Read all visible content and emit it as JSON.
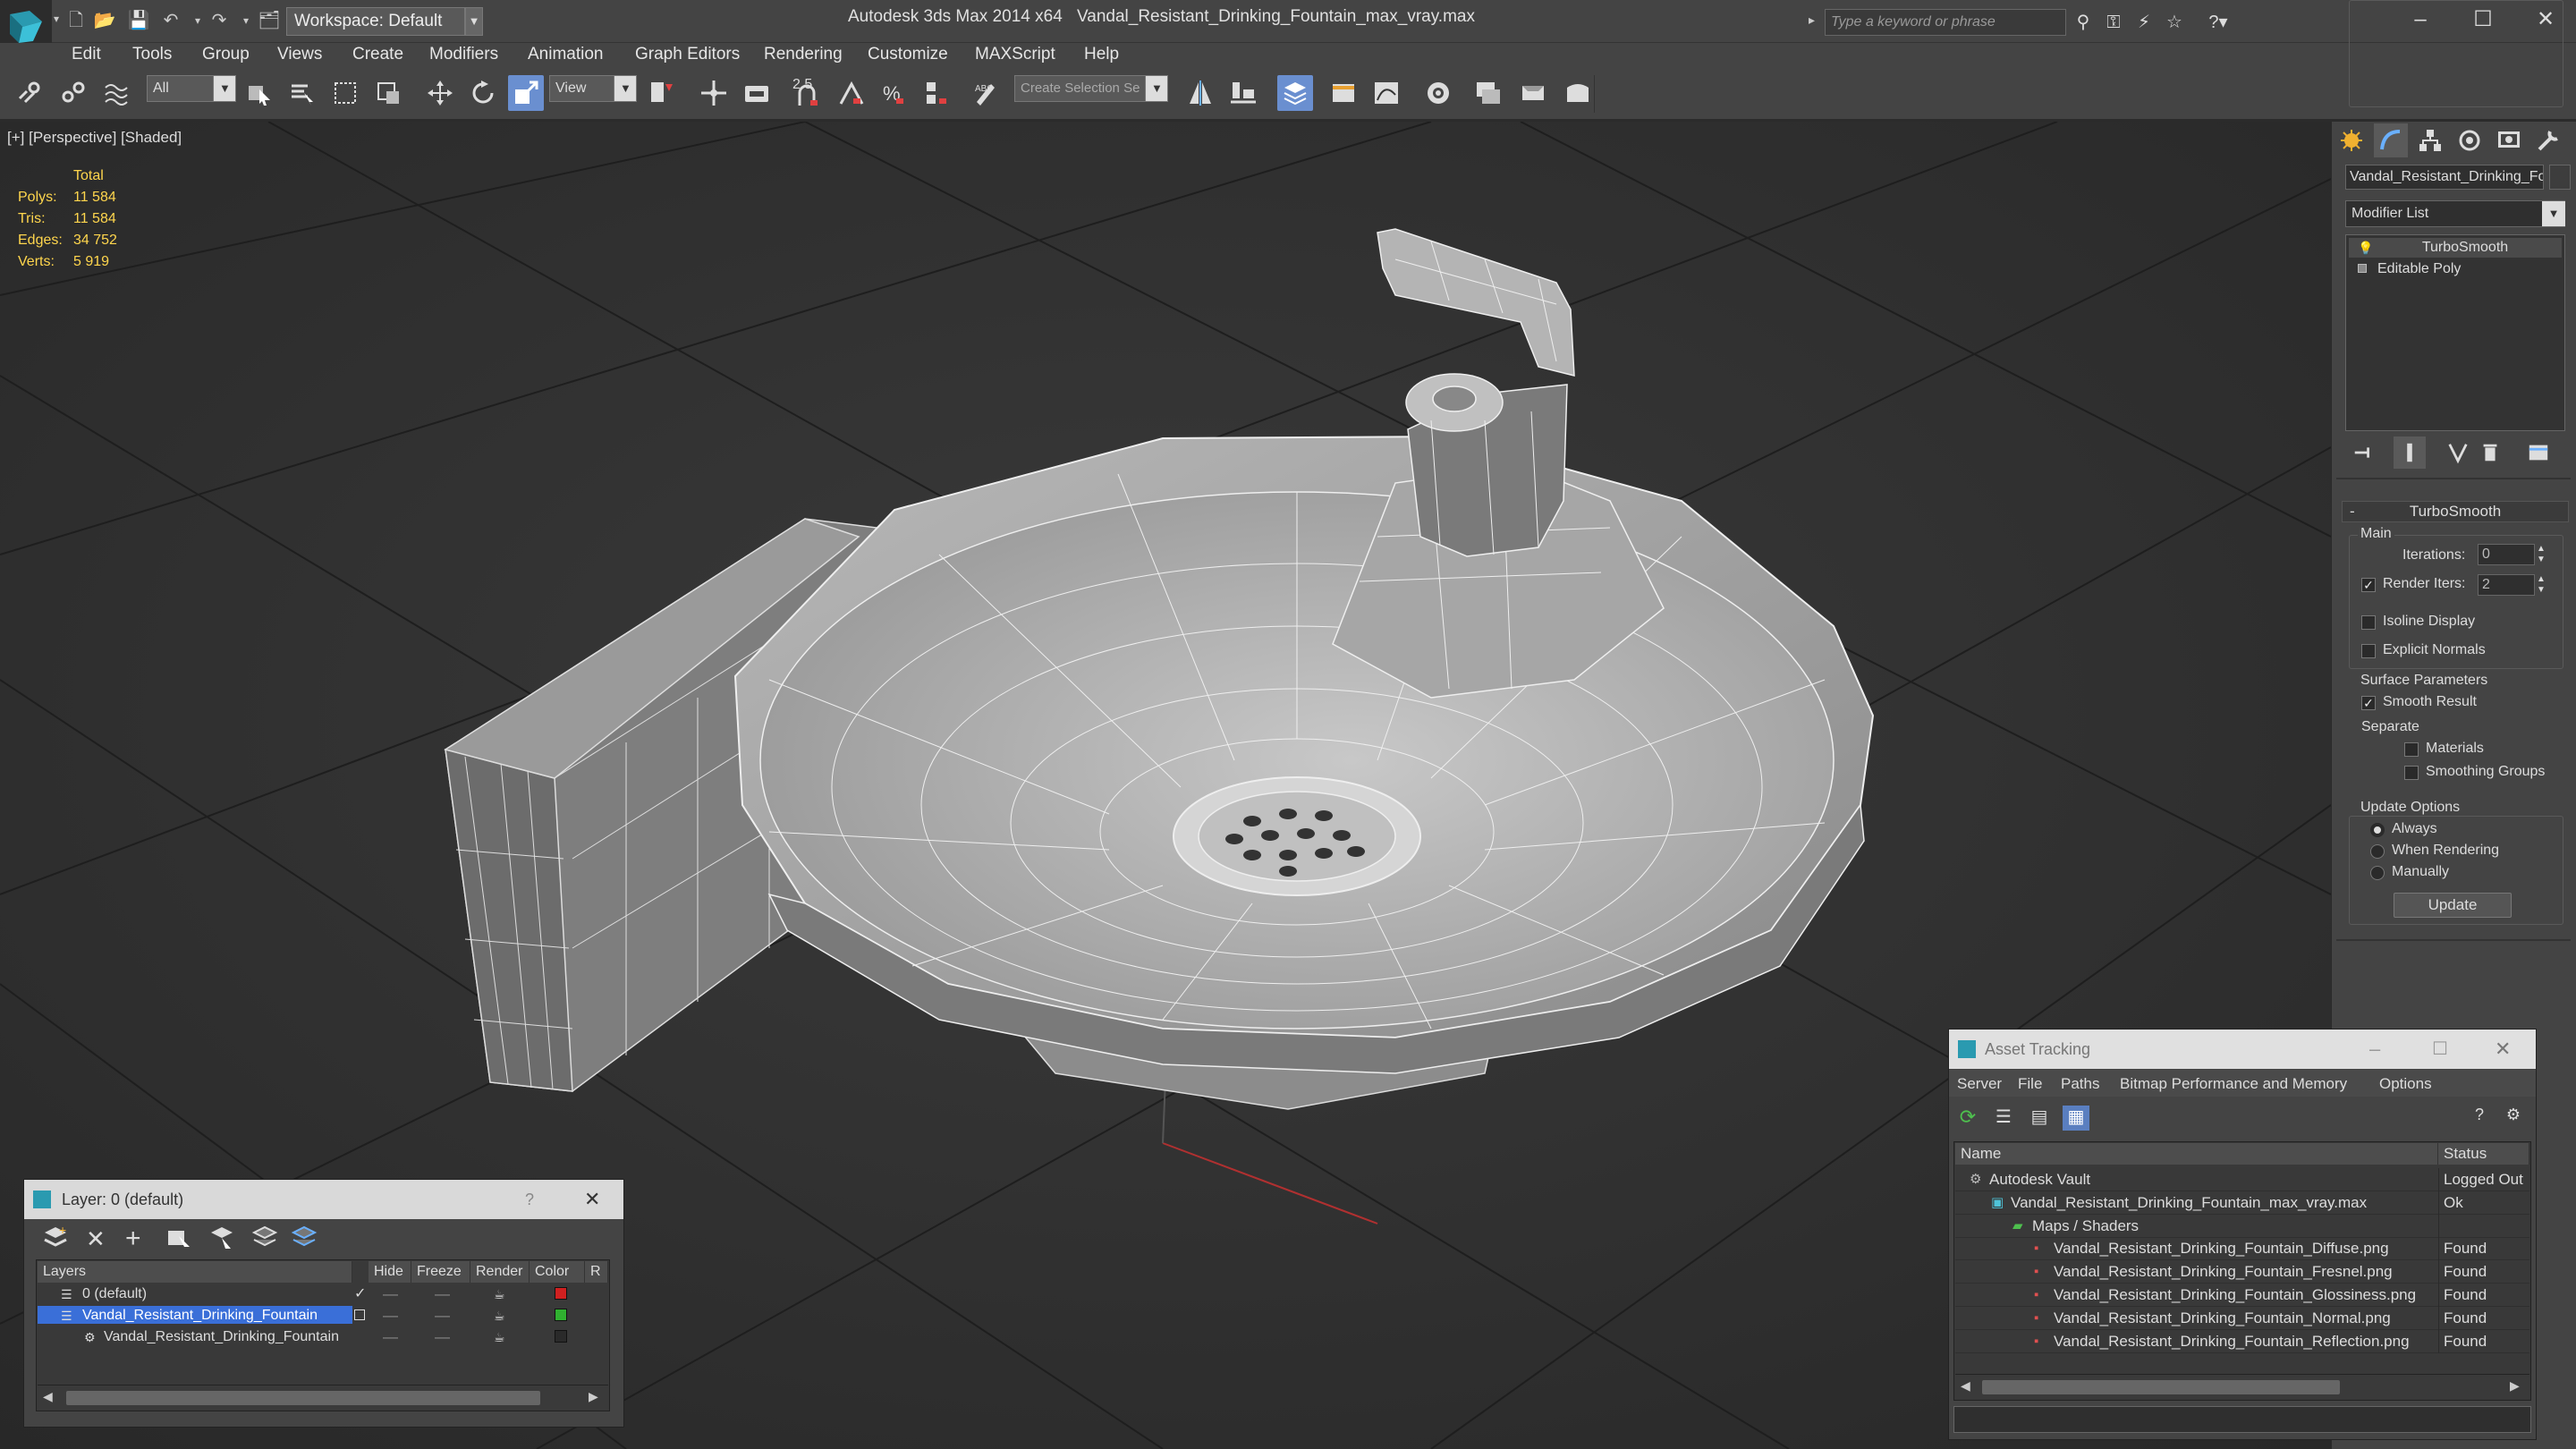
{
  "titlebar": {
    "workspace": "Workspace: Default",
    "app_title": "Autodesk 3ds Max 2014 x64",
    "file_title": "Vandal_Resistant_Drinking_Fountain_max_vray.max",
    "search_placeholder": "Type a keyword or phrase"
  },
  "menubar": {
    "items": [
      "Edit",
      "Tools",
      "Group",
      "Views",
      "Create",
      "Modifiers",
      "Animation",
      "Graph Editors",
      "Rendering",
      "Customize",
      "MAXScript",
      "Help"
    ]
  },
  "toolbar": {
    "filter_value": "All",
    "refcoord_value": "View",
    "snap_label": "2.5",
    "selection_set_placeholder": "Create Selection Se"
  },
  "viewport": {
    "label": "[+] [Perspective] [Shaded]",
    "stats": {
      "header": "Total",
      "rows": [
        {
          "label": "Polys:",
          "value": "11 584"
        },
        {
          "label": "Tris:",
          "value": "11 584"
        },
        {
          "label": "Edges:",
          "value": "34 752"
        },
        {
          "label": "Verts:",
          "value": "5 919"
        }
      ]
    }
  },
  "command_panel": {
    "object_name": "Vandal_Resistant_Drinking_Fo",
    "modifier_list": "Modifier List",
    "stack": [
      "TurboSmooth",
      "Editable Poly"
    ],
    "rollout_title": "TurboSmooth",
    "main_group": "Main",
    "iterations_label": "Iterations:",
    "iterations_value": "0",
    "render_iters_label": "Render Iters:",
    "render_iters_value": "2",
    "isoline_label": "Isoline Display",
    "explicit_normals_label": "Explicit Normals",
    "surface_group": "Surface Parameters",
    "smooth_result_label": "Smooth Result",
    "separate_label": "Separate",
    "materials_label": "Materials",
    "smoothing_groups_label": "Smoothing Groups",
    "update_group": "Update Options",
    "always_label": "Always",
    "when_rendering_label": "When Rendering",
    "manually_label": "Manually",
    "update_button": "Update"
  },
  "layer_window": {
    "title": "Layer: 0 (default)",
    "question": "?",
    "columns": [
      "Layers",
      "Hide",
      "Freeze",
      "Render",
      "Color",
      "R"
    ],
    "rows": [
      {
        "name": "0 (default)",
        "check": "✓",
        "color": "#d02020"
      },
      {
        "name": "Vandal_Resistant_Drinking_Fountain",
        "check": "",
        "color": "#30b030"
      },
      {
        "name": "Vandal_Resistant_Drinking_Fountain",
        "check": "",
        "color": "#2a2a2a"
      }
    ]
  },
  "asset_window": {
    "title": "Asset Tracking",
    "menu": [
      "Server",
      "File",
      "Paths",
      "Bitmap Performance and Memory",
      "Options"
    ],
    "columns": [
      "Name",
      "Status"
    ],
    "rows": [
      {
        "name": "Autodesk Vault",
        "status": "Logged Out"
      },
      {
        "name": "Vandal_Resistant_Drinking_Fountain_max_vray.max",
        "status": "Ok"
      },
      {
        "name": "Maps / Shaders",
        "status": ""
      },
      {
        "name": "Vandal_Resistant_Drinking_Fountain_Diffuse.png",
        "status": "Found"
      },
      {
        "name": "Vandal_Resistant_Drinking_Fountain_Fresnel.png",
        "status": "Found"
      },
      {
        "name": "Vandal_Resistant_Drinking_Fountain_Glossiness.png",
        "status": "Found"
      },
      {
        "name": "Vandal_Resistant_Drinking_Fountain_Normal.png",
        "status": "Found"
      },
      {
        "name": "Vandal_Resistant_Drinking_Fountain_Reflection.png",
        "status": "Found"
      }
    ]
  },
  "colors": {
    "accent_blue": "#3a6fd8",
    "stats_yellow": "#ffd64d"
  }
}
